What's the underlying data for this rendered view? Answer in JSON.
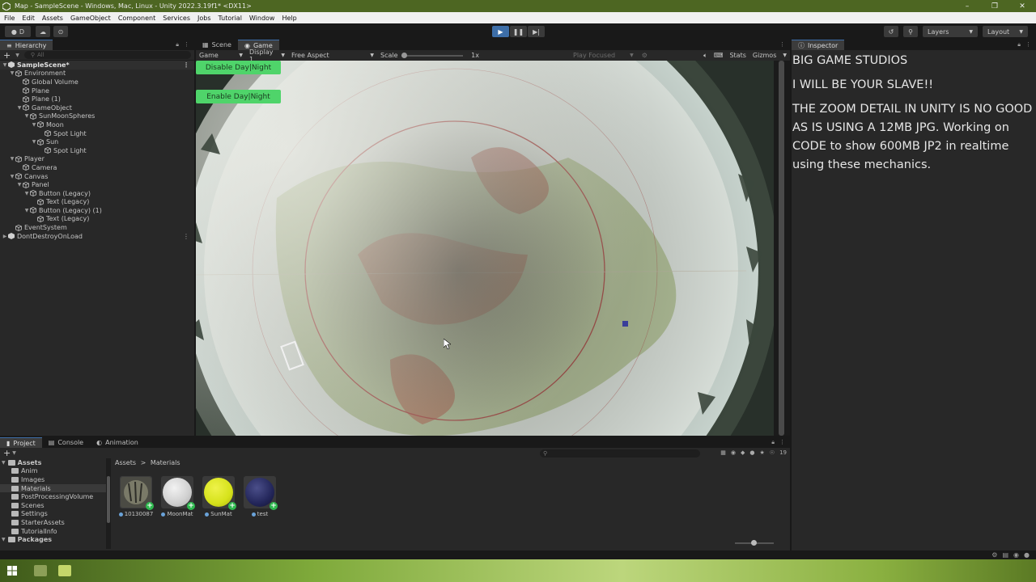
{
  "window": {
    "title": "Map - SampleScene - Windows, Mac, Linux - Unity 2022.3.19f1* <DX11>"
  },
  "menu": [
    "File",
    "Edit",
    "Assets",
    "GameObject",
    "Component",
    "Services",
    "Jobs",
    "Tutorial",
    "Window",
    "Help"
  ],
  "toolbar": {
    "account_label": "D",
    "layers_label": "Layers",
    "layout_label": "Layout"
  },
  "hierarchy": {
    "tab_label": "Hierarchy",
    "search_placeholder": "All",
    "items": [
      {
        "label": "SampleScene*",
        "depth": 0,
        "icon": "unity-scene-icon",
        "expanded": true,
        "bold": true
      },
      {
        "label": "Environment",
        "depth": 1,
        "icon": "cube-icon",
        "expanded": true
      },
      {
        "label": "Global Volume",
        "depth": 2,
        "icon": "cube-icon"
      },
      {
        "label": "Plane",
        "depth": 2,
        "icon": "cube-icon"
      },
      {
        "label": "Plane (1)",
        "depth": 2,
        "icon": "cube-icon"
      },
      {
        "label": "GameObject",
        "depth": 2,
        "icon": "cube-icon",
        "expanded": true
      },
      {
        "label": "SunMoonSpheres",
        "depth": 3,
        "icon": "cube-icon",
        "expanded": true
      },
      {
        "label": "Moon",
        "depth": 4,
        "icon": "cube-icon",
        "expanded": true
      },
      {
        "label": "Spot Light",
        "depth": 5,
        "icon": "cube-icon"
      },
      {
        "label": "Sun",
        "depth": 4,
        "icon": "cube-icon",
        "expanded": true
      },
      {
        "label": "Spot Light",
        "depth": 5,
        "icon": "cube-icon"
      },
      {
        "label": "Player",
        "depth": 1,
        "icon": "cube-icon",
        "expanded": true
      },
      {
        "label": "Camera",
        "depth": 2,
        "icon": "cube-icon"
      },
      {
        "label": "Canvas",
        "depth": 1,
        "icon": "cube-icon",
        "expanded": true
      },
      {
        "label": "Panel",
        "depth": 2,
        "icon": "cube-icon",
        "expanded": true
      },
      {
        "label": "Button (Legacy)",
        "depth": 3,
        "icon": "cube-icon",
        "expanded": true
      },
      {
        "label": "Text (Legacy)",
        "depth": 4,
        "icon": "cube-icon"
      },
      {
        "label": "Button (Legacy) (1)",
        "depth": 3,
        "icon": "cube-icon",
        "expanded": true
      },
      {
        "label": "Text (Legacy)",
        "depth": 4,
        "icon": "cube-icon"
      },
      {
        "label": "EventSystem",
        "depth": 1,
        "icon": "cube-icon"
      },
      {
        "label": "DontDestroyOnLoad",
        "depth": 0,
        "icon": "unity-scene-icon",
        "expanded": false
      }
    ]
  },
  "game_view": {
    "tabs": [
      "Scene",
      "Game"
    ],
    "active_tab": "Game",
    "mode": "Game",
    "display": "Display 1",
    "aspect": "Free Aspect",
    "scale_label": "Scale",
    "scale_value": "1x",
    "play_focused": "Play Focused",
    "stats_label": "Stats",
    "gizmos_label": "Gizmos",
    "buttons": [
      "Disable Day|Night",
      "Enable Day|Night"
    ],
    "button_color": "#4fd46a"
  },
  "inspector": {
    "tab_label": "Inspector",
    "lines": [
      "BIG GAME STUDIOS",
      "I WILL BE YOUR SLAVE!!",
      "THE ZOOM DETAIL IN UNITY IS NO GOOD AS IS USING A 12MB JPG. Working on CODE to show 600MB JP2 in realtime using these mechanics."
    ]
  },
  "project": {
    "tabs": [
      "Project",
      "Console",
      "Animation"
    ],
    "active_tab": "Project",
    "breadcrumb": [
      "Assets",
      "Materials"
    ],
    "hidden_count": "19",
    "tree": [
      {
        "label": "Assets",
        "bold": true,
        "depth": 0
      },
      {
        "label": "Anim",
        "depth": 1
      },
      {
        "label": "Images",
        "depth": 1
      },
      {
        "label": "Materials",
        "depth": 1,
        "selected": true
      },
      {
        "label": "PostProcessingVolume",
        "depth": 1
      },
      {
        "label": "Scenes",
        "depth": 1
      },
      {
        "label": "Settings",
        "depth": 1
      },
      {
        "label": "StarterAssets",
        "depth": 1
      },
      {
        "label": "TutorialInfo",
        "depth": 1
      },
      {
        "label": "Packages",
        "bold": true,
        "depth": 0
      }
    ],
    "assets": [
      {
        "label": "10130087",
        "kind": "map-texture"
      },
      {
        "label": "MoonMat",
        "color": "#dcdcdc"
      },
      {
        "label": "SunMat",
        "color": "#d6e21a"
      },
      {
        "label": "test",
        "color": "#23265a"
      }
    ]
  },
  "colors": {
    "titlebar": "#4d6622",
    "accent": "#3d6ea8",
    "panel": "#282828",
    "add_badge": "#2fb94f"
  }
}
